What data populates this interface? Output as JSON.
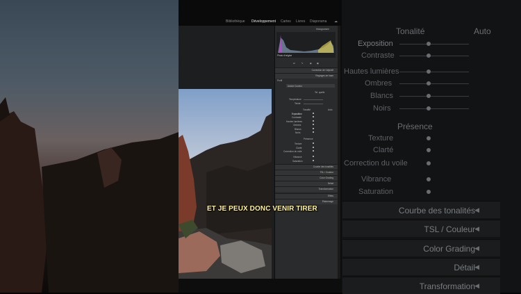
{
  "topbar": {
    "modules": [
      "Bibliothèque",
      "Développement",
      "Cartes",
      "Livres",
      "Diaporama"
    ],
    "active_module": "Développement"
  },
  "panel": {
    "histogram_title": "Histogramme",
    "histogram_label": "Photo d'origine",
    "sections_top": [
      "Correction de l'objectif",
      "Réglages de base"
    ],
    "profile_label": "Profil",
    "profile_value": "Adobe Couleur",
    "wb_label": "Tel. quelle",
    "temp_label": "Température",
    "tint_label": "Teinte",
    "tone_label": "Tonalité",
    "tone_auto": "Auto",
    "tone_rows": [
      "Exposition",
      "Contraste",
      "Hautes lumières",
      "Ombres",
      "Blancs",
      "Noirs"
    ],
    "presence_label": "Présence",
    "presence_rows": [
      "Texture",
      "Clarté",
      "Correction du voile",
      "Vibrance",
      "Saturation"
    ],
    "sections_bottom": [
      "Courbe des tonalités",
      "TSL / Couleur",
      "Color Grading",
      "Détail",
      "Transformation",
      "Effets",
      "Étalonnage"
    ]
  },
  "right_blur": {
    "tone_label": "Tonalité",
    "tone_auto": "Auto",
    "tone_rows": [
      "Exposition",
      "Contraste",
      "Hautes lumières",
      "Ombres",
      "Blancs",
      "Noirs"
    ],
    "presence_label": "Présence",
    "presence_rows": [
      "Texture",
      "Clarté",
      "Correction du voile",
      "Vibrance",
      "Saturation"
    ],
    "sections": [
      "Courbe des tonalités",
      "TSL / Couleur",
      "Color Grading",
      "Détail",
      "Transformation"
    ]
  },
  "caption": "ET JE PEUX DONC VENIR TIRER"
}
